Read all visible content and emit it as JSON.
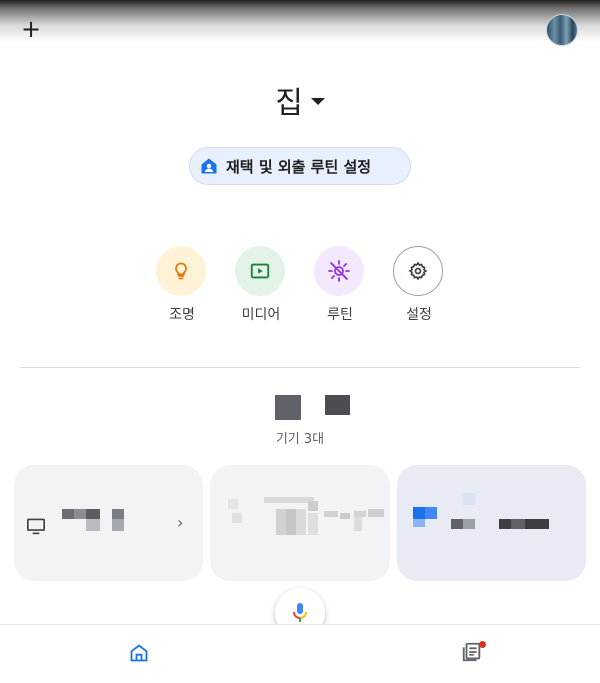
{
  "header": {
    "add_icon": "+"
  },
  "home": {
    "title": "집"
  },
  "routine_chip": {
    "label": "재택 및 외출 루틴 설정"
  },
  "actions": [
    {
      "label": "조명",
      "icon": "lightbulb-icon",
      "bg": "#fef3d6"
    },
    {
      "label": "미디어",
      "icon": "media-icon",
      "bg": "#e3f3e7"
    },
    {
      "label": "루틴",
      "icon": "routine-icon",
      "bg": "#f3e8fd"
    },
    {
      "label": "설정",
      "icon": "gear-icon",
      "bg": "#ffffff"
    }
  ],
  "devices": {
    "count_label": "기기 3대"
  },
  "colors": {
    "accent": "#1a73e8",
    "card": "#f1f3f4",
    "chip": "#e8f0fe"
  }
}
